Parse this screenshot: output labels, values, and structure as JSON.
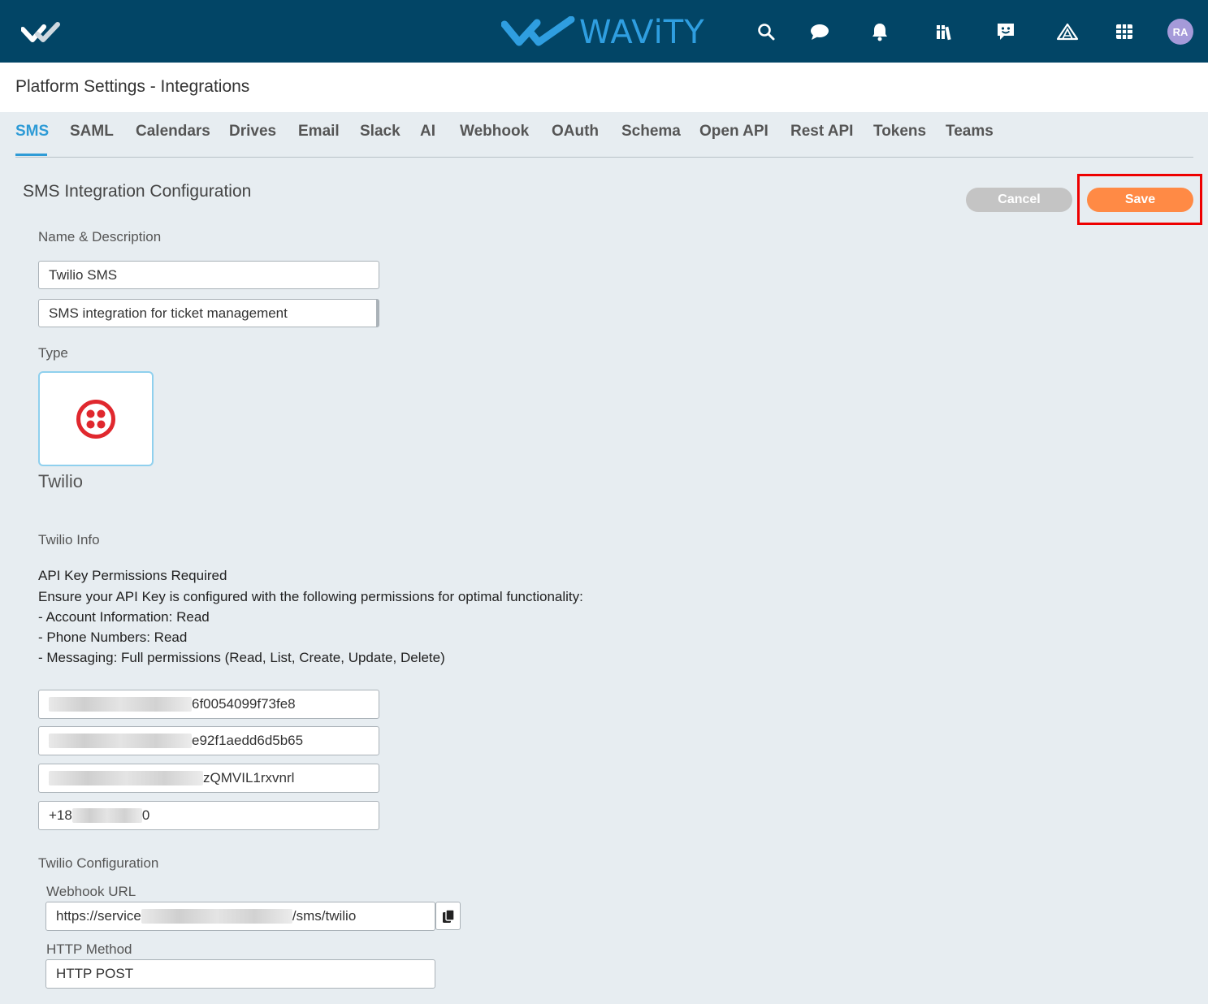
{
  "header": {
    "logo_text": "WAViTY",
    "brand_color": "#2f9ee0",
    "icons": [
      "menu-check-icon",
      "search-icon",
      "chat-icon",
      "bell-icon",
      "library-icon",
      "feedback-icon",
      "tent-icon",
      "grid-icon"
    ],
    "avatar_initials": "RA"
  },
  "page": {
    "title": "Platform Settings - Integrations"
  },
  "tabs": [
    {
      "label": "SMS",
      "active": true
    },
    {
      "label": "SAML"
    },
    {
      "label": "Calendars"
    },
    {
      "label": "Drives"
    },
    {
      "label": "Email"
    },
    {
      "label": "Slack"
    },
    {
      "label": "AI"
    },
    {
      "label": "Webhook"
    },
    {
      "label": "OAuth"
    },
    {
      "label": "Schema"
    },
    {
      "label": "Open API"
    },
    {
      "label": "Rest API"
    },
    {
      "label": "Tokens"
    },
    {
      "label": "Teams"
    }
  ],
  "section": {
    "title": "SMS Integration Configuration"
  },
  "actions": {
    "cancel_label": "Cancel",
    "save_label": "Save"
  },
  "name_desc": {
    "label": "Name & Description",
    "name_value": "Twilio SMS",
    "description_value": "SMS integration for ticket management"
  },
  "type": {
    "label": "Type",
    "selected": "Twilio",
    "logo_icon": "twilio-logo-icon",
    "logo_color": "#e0282e"
  },
  "twilio_info": {
    "label": "Twilio Info",
    "lines": [
      "API Key Permissions Required",
      "Ensure your API Key is configured with the following permissions for optimal functionality:",
      "- Account Information: Read",
      "- Phone Numbers: Read",
      "- Messaging: Full permissions (Read, List, Create, Update, Delete)"
    ],
    "fields": [
      {
        "visible_suffix": "6f0054099f73fe8"
      },
      {
        "visible_suffix": "e92f1aedd6d5b65"
      },
      {
        "visible_suffix": "zQMVIL1rxvnrl"
      },
      {
        "visible_prefix": "+18",
        "visible_suffix": "0"
      }
    ]
  },
  "twilio_config": {
    "label": "Twilio Configuration",
    "webhook_label": "Webhook URL",
    "webhook_prefix": "https://service",
    "webhook_suffix": "/sms/twilio",
    "http_method_label": "HTTP Method",
    "http_method_value": "HTTP POST"
  }
}
